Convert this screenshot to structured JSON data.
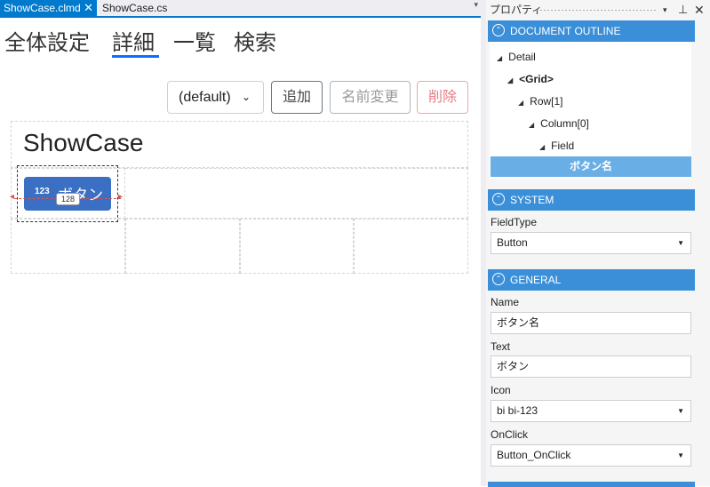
{
  "doc_tabs": {
    "active": "ShowCase.clmd",
    "active_close": "✕",
    "inactive": "ShowCase.cs",
    "dropdown": "▾"
  },
  "nav": {
    "items": [
      "全体設定",
      "詳細",
      "一覧",
      "検索"
    ],
    "active_index": 1
  },
  "toolbar": {
    "select_value": "(default)",
    "select_chevron": "⌄",
    "add_label": "追加",
    "rename_label": "名前変更",
    "delete_label": "削除"
  },
  "canvas": {
    "title": "ShowCase",
    "button_icon": "123",
    "button_text": "ボタン",
    "width_badge": "128",
    "arrow_left": "◂",
    "arrow_right": "▸"
  },
  "panel": {
    "title": "プロパティ",
    "menu_icon": "▾",
    "pin_icon": "⊥",
    "close_icon": "✕"
  },
  "outline": {
    "header": "DOCUMENT OUTLINE",
    "collapse_icon": "⌃",
    "tree_marker": "◢",
    "items": [
      "Detail",
      "<Grid>",
      "Row[1]",
      "Column[0]",
      "Field"
    ],
    "selected": "ボタン名"
  },
  "system": {
    "header": "SYSTEM",
    "fieldtype_label": "FieldType",
    "fieldtype_value": "Button"
  },
  "general": {
    "header": "GENERAL",
    "name_label": "Name",
    "name_value": "ボタン名",
    "text_label": "Text",
    "text_value": "ボタン",
    "icon_label": "Icon",
    "icon_value": "bi bi-123",
    "onclick_label": "OnClick",
    "onclick_value": "Button_OnClick",
    "dropdown_icon": "▼"
  },
  "colors": {
    "accent": "#007acc",
    "section_header": "#3a8fd8",
    "tree_selection": "#6aaee6",
    "field_button": "#3a6fc4",
    "delete": "#e57c86"
  }
}
